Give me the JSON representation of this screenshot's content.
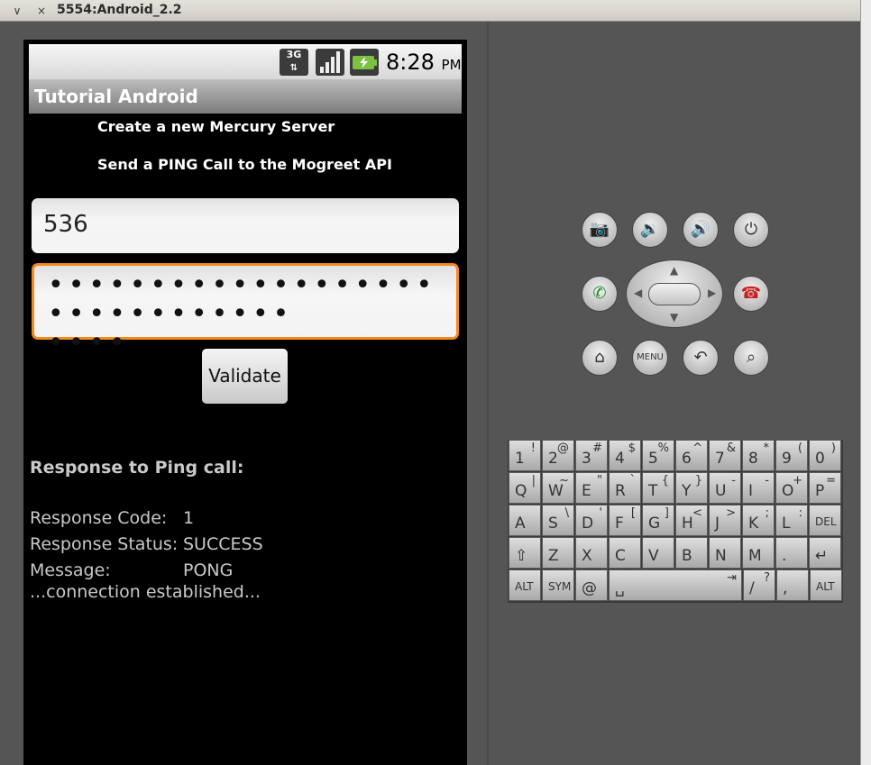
{
  "window": {
    "title": "5554:Android_2.2",
    "minimize_glyph": "∨",
    "close_glyph": "×"
  },
  "status_bar": {
    "network": "3G",
    "time": "8:28",
    "ampm": "PM",
    "icons": [
      "3g-data-icon",
      "signal-icon",
      "battery-charging-icon"
    ]
  },
  "app": {
    "title": "Tutorial Android",
    "line1": "Create a new Mercury Server",
    "line2": "Send a PING Call to the Mogreet API",
    "user_value": "536",
    "password_value": "•••••••••••••••••••••••••••••••",
    "password_line2": "••••",
    "validate_label": "Validate",
    "response_heading": "Response to Ping call:",
    "response": {
      "code_label": "Response Code:",
      "code_value": "1",
      "status_label": "Response Status:",
      "status_value": "SUCCESS",
      "message_label": "Message:",
      "message_value": "PONG"
    },
    "footer": "...connection established..."
  },
  "hardware": {
    "menu_label": "MENU"
  },
  "keyboard": {
    "row1": [
      [
        "1",
        "!"
      ],
      [
        "2",
        "@"
      ],
      [
        "3",
        "#"
      ],
      [
        "4",
        "$"
      ],
      [
        "5",
        "%"
      ],
      [
        "6",
        "^"
      ],
      [
        "7",
        "&"
      ],
      [
        "8",
        "*"
      ],
      [
        "9",
        "("
      ],
      [
        "0",
        ")"
      ]
    ],
    "row2": [
      [
        "Q",
        "|"
      ],
      [
        "W",
        "~"
      ],
      [
        "E",
        "\""
      ],
      [
        "R",
        "`"
      ],
      [
        "T",
        "{"
      ],
      [
        "Y",
        "}"
      ],
      [
        "U",
        "-"
      ],
      [
        "I",
        "-"
      ],
      [
        "O",
        "+"
      ],
      [
        "P",
        "="
      ]
    ],
    "row3": [
      [
        "A",
        ""
      ],
      [
        "S",
        "\\"
      ],
      [
        "D",
        "'"
      ],
      [
        "F",
        "["
      ],
      [
        "G",
        "]"
      ],
      [
        "H",
        "<"
      ],
      [
        "J",
        ">"
      ],
      [
        "K",
        ";"
      ],
      [
        "L",
        ":"
      ],
      [
        "DEL",
        ""
      ]
    ],
    "row4": [
      [
        "⇧",
        ""
      ],
      [
        "Z",
        ""
      ],
      [
        "X",
        ""
      ],
      [
        "C",
        ""
      ],
      [
        "V",
        ""
      ],
      [
        "B",
        ""
      ],
      [
        "N",
        ""
      ],
      [
        "M",
        ""
      ],
      [
        ".",
        ""
      ],
      [
        "↵",
        ""
      ]
    ],
    "row5": [
      [
        "ALT",
        ""
      ],
      [
        "SYM",
        ""
      ],
      [
        "@",
        ""
      ],
      [
        "␣",
        "⇥"
      ],
      [
        "/",
        "?"
      ],
      [
        ",",
        ""
      ],
      [
        "ALT",
        ""
      ]
    ]
  }
}
